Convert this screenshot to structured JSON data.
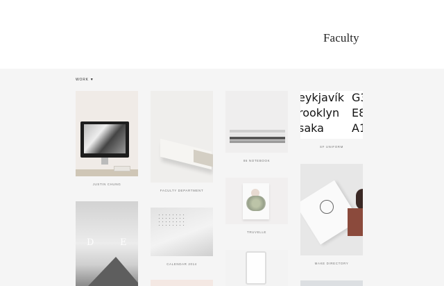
{
  "header": {
    "brand": "Faculty"
  },
  "filter": {
    "label": "WORK",
    "caret": "▾"
  },
  "projects": [
    {
      "caption": "JUSTIN CHUNG"
    },
    {
      "caption": "FACULTY DEPARTMENT"
    },
    {
      "caption": "86 NOTEBOOK"
    },
    {
      "caption": "SF UNIFORM"
    },
    {
      "caption": "TRUVELLE"
    },
    {
      "caption": "MAKE DIRECTORY"
    },
    {
      "caption": "CALENDAR 2014"
    }
  ],
  "type_specimen": {
    "rows": [
      "eykjavík",
      "rooklyn",
      "saka"
    ],
    "column2": [
      "G3",
      "E8",
      "A1"
    ]
  },
  "dye_letters": [
    "D",
    "E"
  ]
}
